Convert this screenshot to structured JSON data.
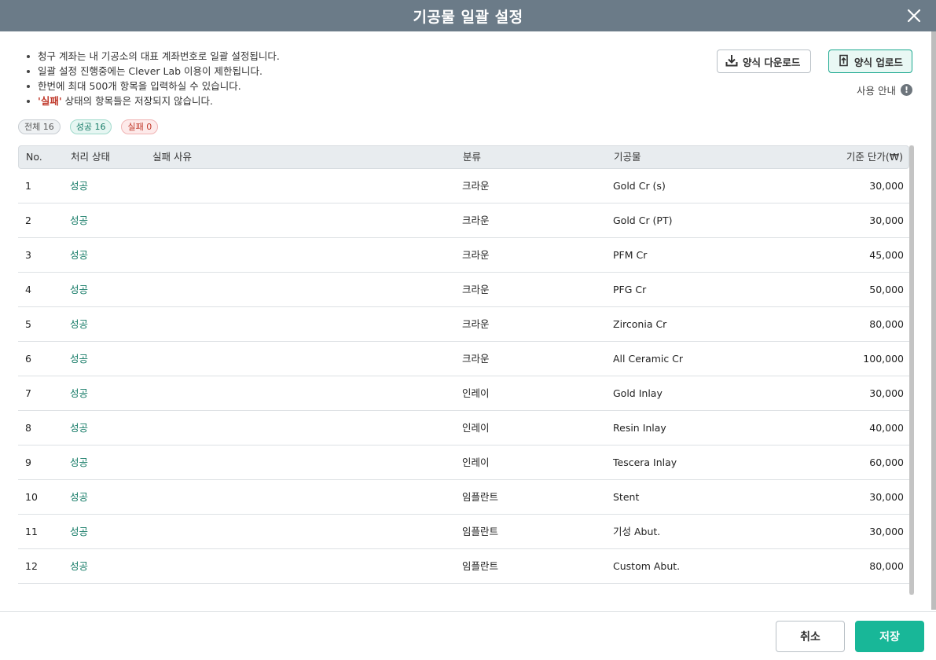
{
  "modal": {
    "title": "기공물 일괄 설정"
  },
  "notes": {
    "line1": "청구 계좌는 내 기공소의 대표 계좌번호로 일괄 설정됩니다.",
    "line2": "일괄 설정 진행중에는 Clever Lab 이용이 제한됩니다.",
    "line3": "한번에 최대 500개 항목을 입력하실 수 있습니다.",
    "line4_highlight": "'실패'",
    "line4_rest": " 상태의 항목들은 저장되지 않습니다."
  },
  "actions": {
    "download_label": "양식 다운로드",
    "upload_label": "양식 업로드",
    "usage_label": "사용 안내",
    "usage_icon_text": "!"
  },
  "badges": {
    "all": "전체 16",
    "success": "성공 16",
    "fail": "실패 0"
  },
  "table": {
    "headers": {
      "no": "No.",
      "status": "처리 상태",
      "reason": "실패 사유",
      "category": "분류",
      "item": "기공물",
      "price": "기준 단가(₩)"
    },
    "rows": [
      {
        "no": "1",
        "status": "성공",
        "reason": "",
        "category": "크라운",
        "item": "Gold Cr (s)",
        "price": "30,000"
      },
      {
        "no": "2",
        "status": "성공",
        "reason": "",
        "category": "크라운",
        "item": "Gold Cr (PT)",
        "price": "30,000"
      },
      {
        "no": "3",
        "status": "성공",
        "reason": "",
        "category": "크라운",
        "item": "PFM Cr",
        "price": "45,000"
      },
      {
        "no": "4",
        "status": "성공",
        "reason": "",
        "category": "크라운",
        "item": "PFG Cr",
        "price": "50,000"
      },
      {
        "no": "5",
        "status": "성공",
        "reason": "",
        "category": "크라운",
        "item": "Zirconia Cr",
        "price": "80,000"
      },
      {
        "no": "6",
        "status": "성공",
        "reason": "",
        "category": "크라운",
        "item": "All Ceramic Cr",
        "price": "100,000"
      },
      {
        "no": "7",
        "status": "성공",
        "reason": "",
        "category": "인레이",
        "item": "Gold Inlay",
        "price": "30,000"
      },
      {
        "no": "8",
        "status": "성공",
        "reason": "",
        "category": "인레이",
        "item": "Resin Inlay",
        "price": "40,000"
      },
      {
        "no": "9",
        "status": "성공",
        "reason": "",
        "category": "인레이",
        "item": "Tescera Inlay",
        "price": "60,000"
      },
      {
        "no": "10",
        "status": "성공",
        "reason": "",
        "category": "임플란트",
        "item": "Stent",
        "price": "30,000"
      },
      {
        "no": "11",
        "status": "성공",
        "reason": "",
        "category": "임플란트",
        "item": "기성 Abut.",
        "price": "30,000"
      },
      {
        "no": "12",
        "status": "성공",
        "reason": "",
        "category": "임플란트",
        "item": "Custom Abut.",
        "price": "80,000"
      }
    ]
  },
  "footer": {
    "cancel_label": "취소",
    "save_label": "저장"
  },
  "colors": {
    "header_bg": "#6b7b88",
    "accent": "#18b798",
    "success_text": "#147a66",
    "fail_text": "#c0392b"
  }
}
